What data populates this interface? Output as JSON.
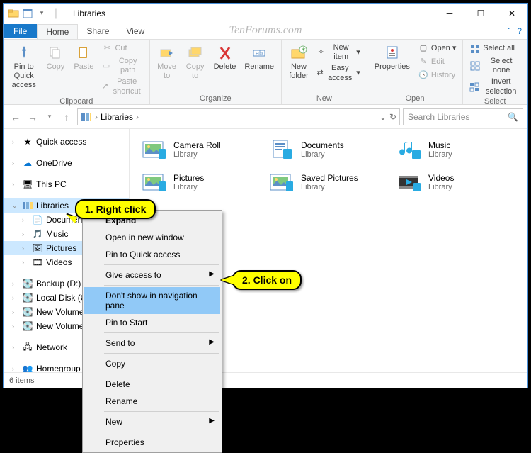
{
  "watermark": "TenForums.com",
  "titlebar": {
    "title": "Libraries"
  },
  "menubar": {
    "file": "File",
    "tabs": [
      "Home",
      "Share",
      "View"
    ]
  },
  "ribbon": {
    "groups": {
      "clipboard": {
        "label": "Clipboard",
        "pin": "Pin to Quick\naccess",
        "copy": "Copy",
        "paste": "Paste",
        "cut": "Cut",
        "copypath": "Copy path",
        "pasteshortcut": "Paste shortcut"
      },
      "organize": {
        "label": "Organize",
        "moveto": "Move\nto",
        "copyto": "Copy\nto",
        "delete": "Delete",
        "rename": "Rename"
      },
      "new": {
        "label": "New",
        "newfolder": "New\nfolder",
        "newitem": "New item",
        "easyaccess": "Easy access"
      },
      "open": {
        "label": "Open",
        "properties": "Properties",
        "open": "Open",
        "edit": "Edit",
        "history": "History"
      },
      "select": {
        "label": "Select",
        "selectall": "Select all",
        "selectnone": "Select none",
        "invert": "Invert selection"
      }
    }
  },
  "address": {
    "path_root": "Libraries",
    "search_placeholder": "Search Libraries"
  },
  "sidebar": {
    "quickaccess": "Quick access",
    "onedrive": "OneDrive",
    "thispc": "This PC",
    "libraries": "Libraries",
    "lib": {
      "documents": "Documents",
      "music": "Music",
      "pictures": "Pictures",
      "videos": "Videos"
    },
    "drives": {
      "backup": "Backup (D:)",
      "local": "Local Disk (C:)",
      "nv1": "New Volume (E:)",
      "nv2": "New Volume (F:)"
    },
    "network": "Network",
    "homegroup": "Homegroup"
  },
  "libraries": [
    {
      "name": "Camera Roll",
      "sub": "Library",
      "icon": "picture"
    },
    {
      "name": "Documents",
      "sub": "Library",
      "icon": "document"
    },
    {
      "name": "Music",
      "sub": "Library",
      "icon": "music"
    },
    {
      "name": "Pictures",
      "sub": "Library",
      "icon": "picture"
    },
    {
      "name": "Saved Pictures",
      "sub": "Library",
      "icon": "picture"
    },
    {
      "name": "Videos",
      "sub": "Library",
      "icon": "video"
    }
  ],
  "context": {
    "expand": "Expand",
    "opennew": "Open in new window",
    "pinqa": "Pin to Quick access",
    "giveaccess": "Give access to",
    "dontshow": "Don't show in navigation pane",
    "pinstart": "Pin to Start",
    "sendto": "Send to",
    "copy": "Copy",
    "delete": "Delete",
    "rename": "Rename",
    "new": "New",
    "properties": "Properties"
  },
  "callouts": {
    "c1": "1. Right click",
    "c2": "2. Click on"
  },
  "status": {
    "items": "6 items"
  }
}
